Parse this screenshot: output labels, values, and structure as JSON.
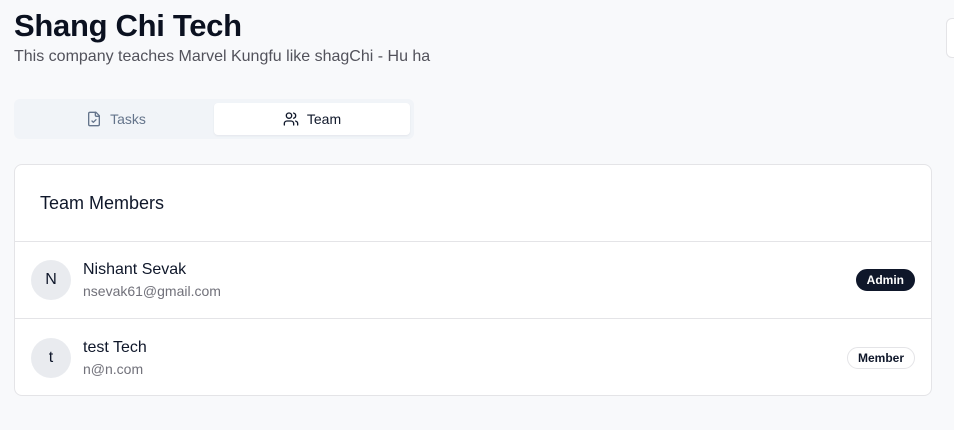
{
  "company": {
    "name": "Shang Chi Tech",
    "description": "This company teaches Marvel Kungfu like shagChi - Hu ha"
  },
  "tabs": [
    {
      "label": "Tasks",
      "icon": "file-check-icon",
      "active": false
    },
    {
      "label": "Team",
      "icon": "users-icon",
      "active": true
    }
  ],
  "team": {
    "title": "Team Members",
    "members": [
      {
        "initial": "N",
        "name": "Nishant Sevak",
        "email": "nsevak61@gmail.com",
        "role": "Admin"
      },
      {
        "initial": "t",
        "name": "test Tech",
        "email": "n@n.com",
        "role": "Member"
      }
    ]
  },
  "colors": {
    "background": "#f8f9fb",
    "admin_badge": "#0f172a",
    "border": "#e4e4e7",
    "muted_text": "#71717a"
  }
}
